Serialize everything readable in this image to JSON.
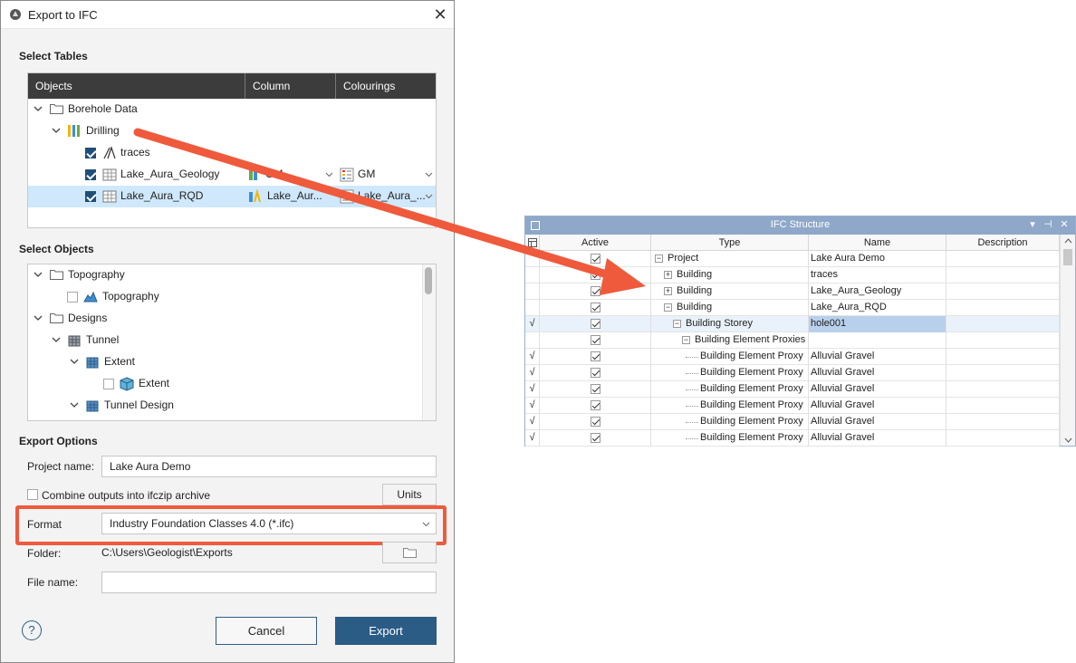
{
  "dialog": {
    "title": "Export to IFC",
    "close_glyph": "✕",
    "sections": {
      "select_tables": "Select Tables",
      "select_objects": "Select Objects",
      "export_options": "Export Options"
    },
    "tables": {
      "columns": [
        "Objects",
        "Column",
        "Colourings"
      ],
      "rows": [
        {
          "label": "Borehole Data",
          "icon": "folder-icon",
          "expanded": true
        },
        {
          "label": "Drilling",
          "icon": "drilling-icon",
          "expanded": true
        },
        {
          "label": "traces",
          "icon": "traces-icon",
          "checked": true
        },
        {
          "label": "Lake_Aura_Geology",
          "icon": "table-icon",
          "checked": true,
          "column": "GM",
          "colouring": "GM"
        },
        {
          "label": "Lake_Aura_RQD",
          "icon": "table-icon",
          "checked": true,
          "column": "Lake_Aur...",
          "colouring": "Lake_Aura_...",
          "selected": true
        }
      ]
    },
    "objects": {
      "rows": [
        {
          "label": "Topography",
          "icon": "folder-icon",
          "expanded": true
        },
        {
          "label": "Topography",
          "icon": "surface-icon",
          "checked": false
        },
        {
          "label": "Designs",
          "icon": "folder-icon",
          "expanded": true
        },
        {
          "label": "Tunnel",
          "icon": "block-icon",
          "expanded": true
        },
        {
          "label": "Extent",
          "icon": "block-icon",
          "expanded": true
        },
        {
          "label": "Extent",
          "icon": "solid-icon",
          "checked": false
        },
        {
          "label": "Tunnel Design",
          "icon": "block-icon",
          "expanded": true
        }
      ]
    },
    "options": {
      "project_name_label": "Project name:",
      "project_name_value": "Lake Aura Demo",
      "combine_label": "Combine outputs into ifczip archive",
      "combine_checked": false,
      "units_button": "Units",
      "format_label": "Format",
      "format_value": "Industry Foundation Classes 4.0 (*.ifc)",
      "folder_label": "Folder:",
      "folder_value": "C:\\Users\\Geologist\\Exports",
      "file_name_label": "File name:",
      "file_name_value": ""
    },
    "footer": {
      "help": "?",
      "cancel": "Cancel",
      "export": "Export"
    }
  },
  "ifc_structure": {
    "title": "IFC Structure",
    "columns": [
      "Active",
      "Type",
      "Name",
      "Description"
    ],
    "rows": [
      {
        "flag": "",
        "type": "Project",
        "name": "Lake Aura Demo",
        "level": 0,
        "expander": "−"
      },
      {
        "flag": "",
        "type": "Building",
        "name": "traces",
        "level": 1,
        "expander": "+"
      },
      {
        "flag": "",
        "type": "Building",
        "name": "Lake_Aura_Geology",
        "level": 1,
        "expander": "+"
      },
      {
        "flag": "",
        "type": "Building",
        "name": "Lake_Aura_RQD",
        "level": 1,
        "expander": "−"
      },
      {
        "flag": "√",
        "type": "Building Storey",
        "name": "hole001",
        "level": 2,
        "expander": "−",
        "selected": true
      },
      {
        "flag": "",
        "type": "Building Element Proxies",
        "name": "",
        "level": 3,
        "expander": "−"
      },
      {
        "flag": "√",
        "type": "Building Element Proxy",
        "name": "Alluvial Gravel",
        "level": 4
      },
      {
        "flag": "√",
        "type": "Building Element Proxy",
        "name": "Alluvial Gravel",
        "level": 4
      },
      {
        "flag": "√",
        "type": "Building Element Proxy",
        "name": "Alluvial Gravel",
        "level": 4
      },
      {
        "flag": "√",
        "type": "Building Element Proxy",
        "name": "Alluvial Gravel",
        "level": 4
      },
      {
        "flag": "√",
        "type": "Building Element Proxy",
        "name": "Alluvial Gravel",
        "level": 4
      },
      {
        "flag": "√",
        "type": "Building Element Proxy",
        "name": "Alluvial Gravel",
        "level": 4
      }
    ]
  },
  "colors": {
    "accent": "#2a5c86",
    "highlight": "#ef5a3c",
    "header_dark": "#3c3c3c",
    "selection": "#cfe8fb"
  }
}
